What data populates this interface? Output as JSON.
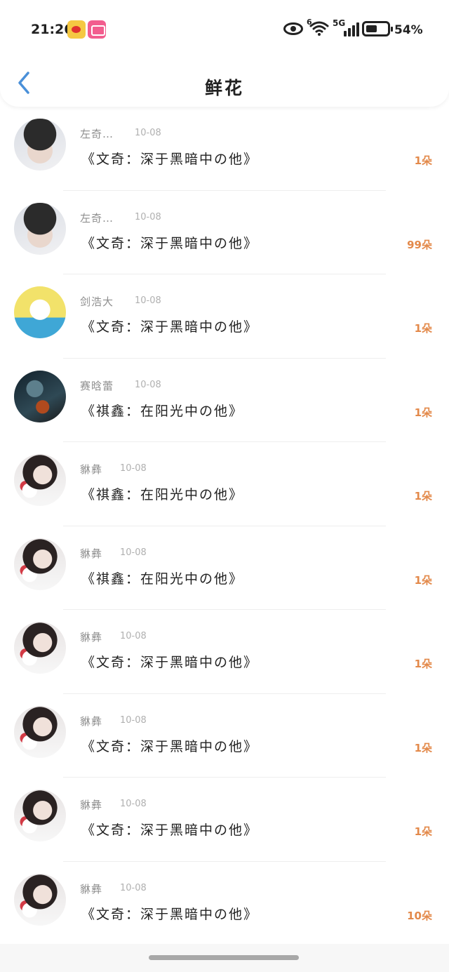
{
  "status_bar": {
    "time": "21:26",
    "wifi_badge": "6",
    "network": "5G",
    "battery_level": 0.54,
    "battery_text": "54%",
    "icons": [
      "weibo-app-icon",
      "bilibili-app-icon",
      "eye-icon",
      "wifi-icon",
      "signal-icon",
      "battery-icon"
    ]
  },
  "header": {
    "title": "鲜花",
    "back_icon": "chevron-left-icon"
  },
  "colors": {
    "accent": "#4a90d9",
    "count": "#e3894a",
    "name": "#8e8e8e",
    "date": "#b0b0b0"
  },
  "records": [
    {
      "name": "左奇…",
      "date": "10-08",
      "item": "《文奇：深于黑暗中の他》",
      "count": "1朵",
      "avatar": "boy"
    },
    {
      "name": "左奇…",
      "date": "10-08",
      "item": "《文奇：深于黑暗中の他》",
      "count": "99朵",
      "avatar": "boy"
    },
    {
      "name": "剑浩大",
      "date": "10-08",
      "item": "《文奇：深于黑暗中の他》",
      "count": "1朵",
      "avatar": "cartoon"
    },
    {
      "name": "赛晗蕾",
      "date": "10-08",
      "item": "《祺鑫：在阳光中の他》",
      "count": "1朵",
      "avatar": "dark"
    },
    {
      "name": "貅彝",
      "date": "10-08",
      "item": "《祺鑫：在阳光中の他》",
      "count": "1朵",
      "avatar": "girl"
    },
    {
      "name": "貅彝",
      "date": "10-08",
      "item": "《祺鑫：在阳光中の他》",
      "count": "1朵",
      "avatar": "girl"
    },
    {
      "name": "貅彝",
      "date": "10-08",
      "item": "《文奇：深于黑暗中の他》",
      "count": "1朵",
      "avatar": "girl"
    },
    {
      "name": "貅彝",
      "date": "10-08",
      "item": "《文奇：深于黑暗中の他》",
      "count": "1朵",
      "avatar": "girl"
    },
    {
      "name": "貅彝",
      "date": "10-08",
      "item": "《文奇：深于黑暗中の他》",
      "count": "1朵",
      "avatar": "girl"
    },
    {
      "name": "貅彝",
      "date": "10-08",
      "item": "《文奇：深于黑暗中の他》",
      "count": "10朵",
      "avatar": "girl"
    }
  ]
}
